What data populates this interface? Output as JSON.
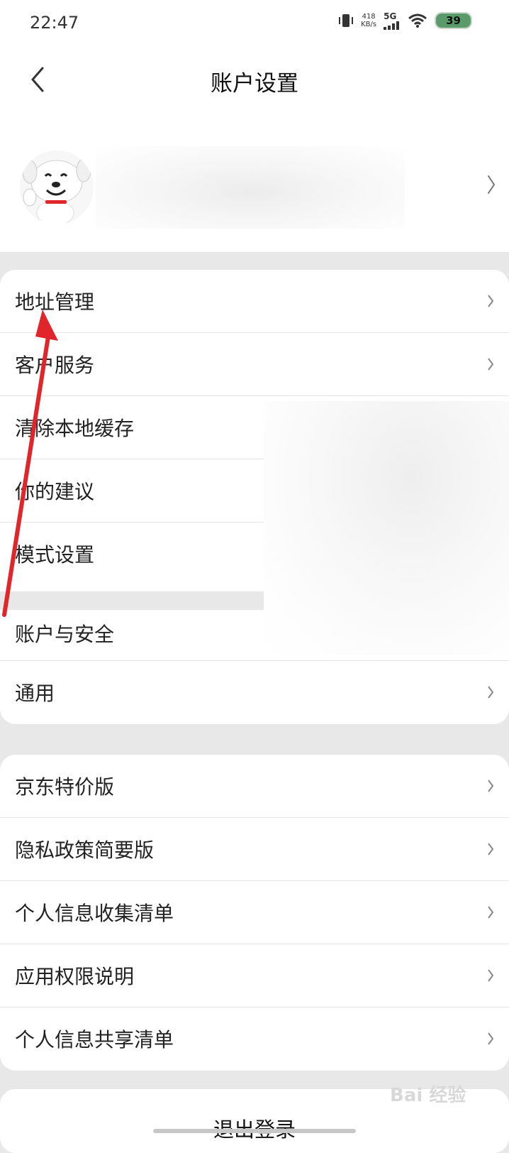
{
  "status_bar": {
    "time": "22:47",
    "net_speed_value": "418",
    "net_speed_unit": "KB/s",
    "network": "5G",
    "battery": "39"
  },
  "header": {
    "title": "账户设置"
  },
  "profile": {},
  "group1": [
    {
      "label": "地址管理"
    },
    {
      "label": "客户服务"
    },
    {
      "label": "清除本地缓存"
    },
    {
      "label": "你的建议"
    },
    {
      "label": "模式设置"
    },
    {
      "label": "账户与安全"
    },
    {
      "label": "通用"
    }
  ],
  "group2": [
    {
      "label": "京东特价版"
    },
    {
      "label": "隐私政策简要版"
    },
    {
      "label": "个人信息收集清单"
    },
    {
      "label": "应用权限说明"
    },
    {
      "label": "个人信息共享清单"
    }
  ],
  "logout": {
    "label": "退出登录"
  },
  "watermark": "Bai 经验",
  "colors": {
    "annotation_arrow": "#e0252b",
    "page_bg": "#e8e8e8",
    "card_bg": "#ffffff"
  }
}
